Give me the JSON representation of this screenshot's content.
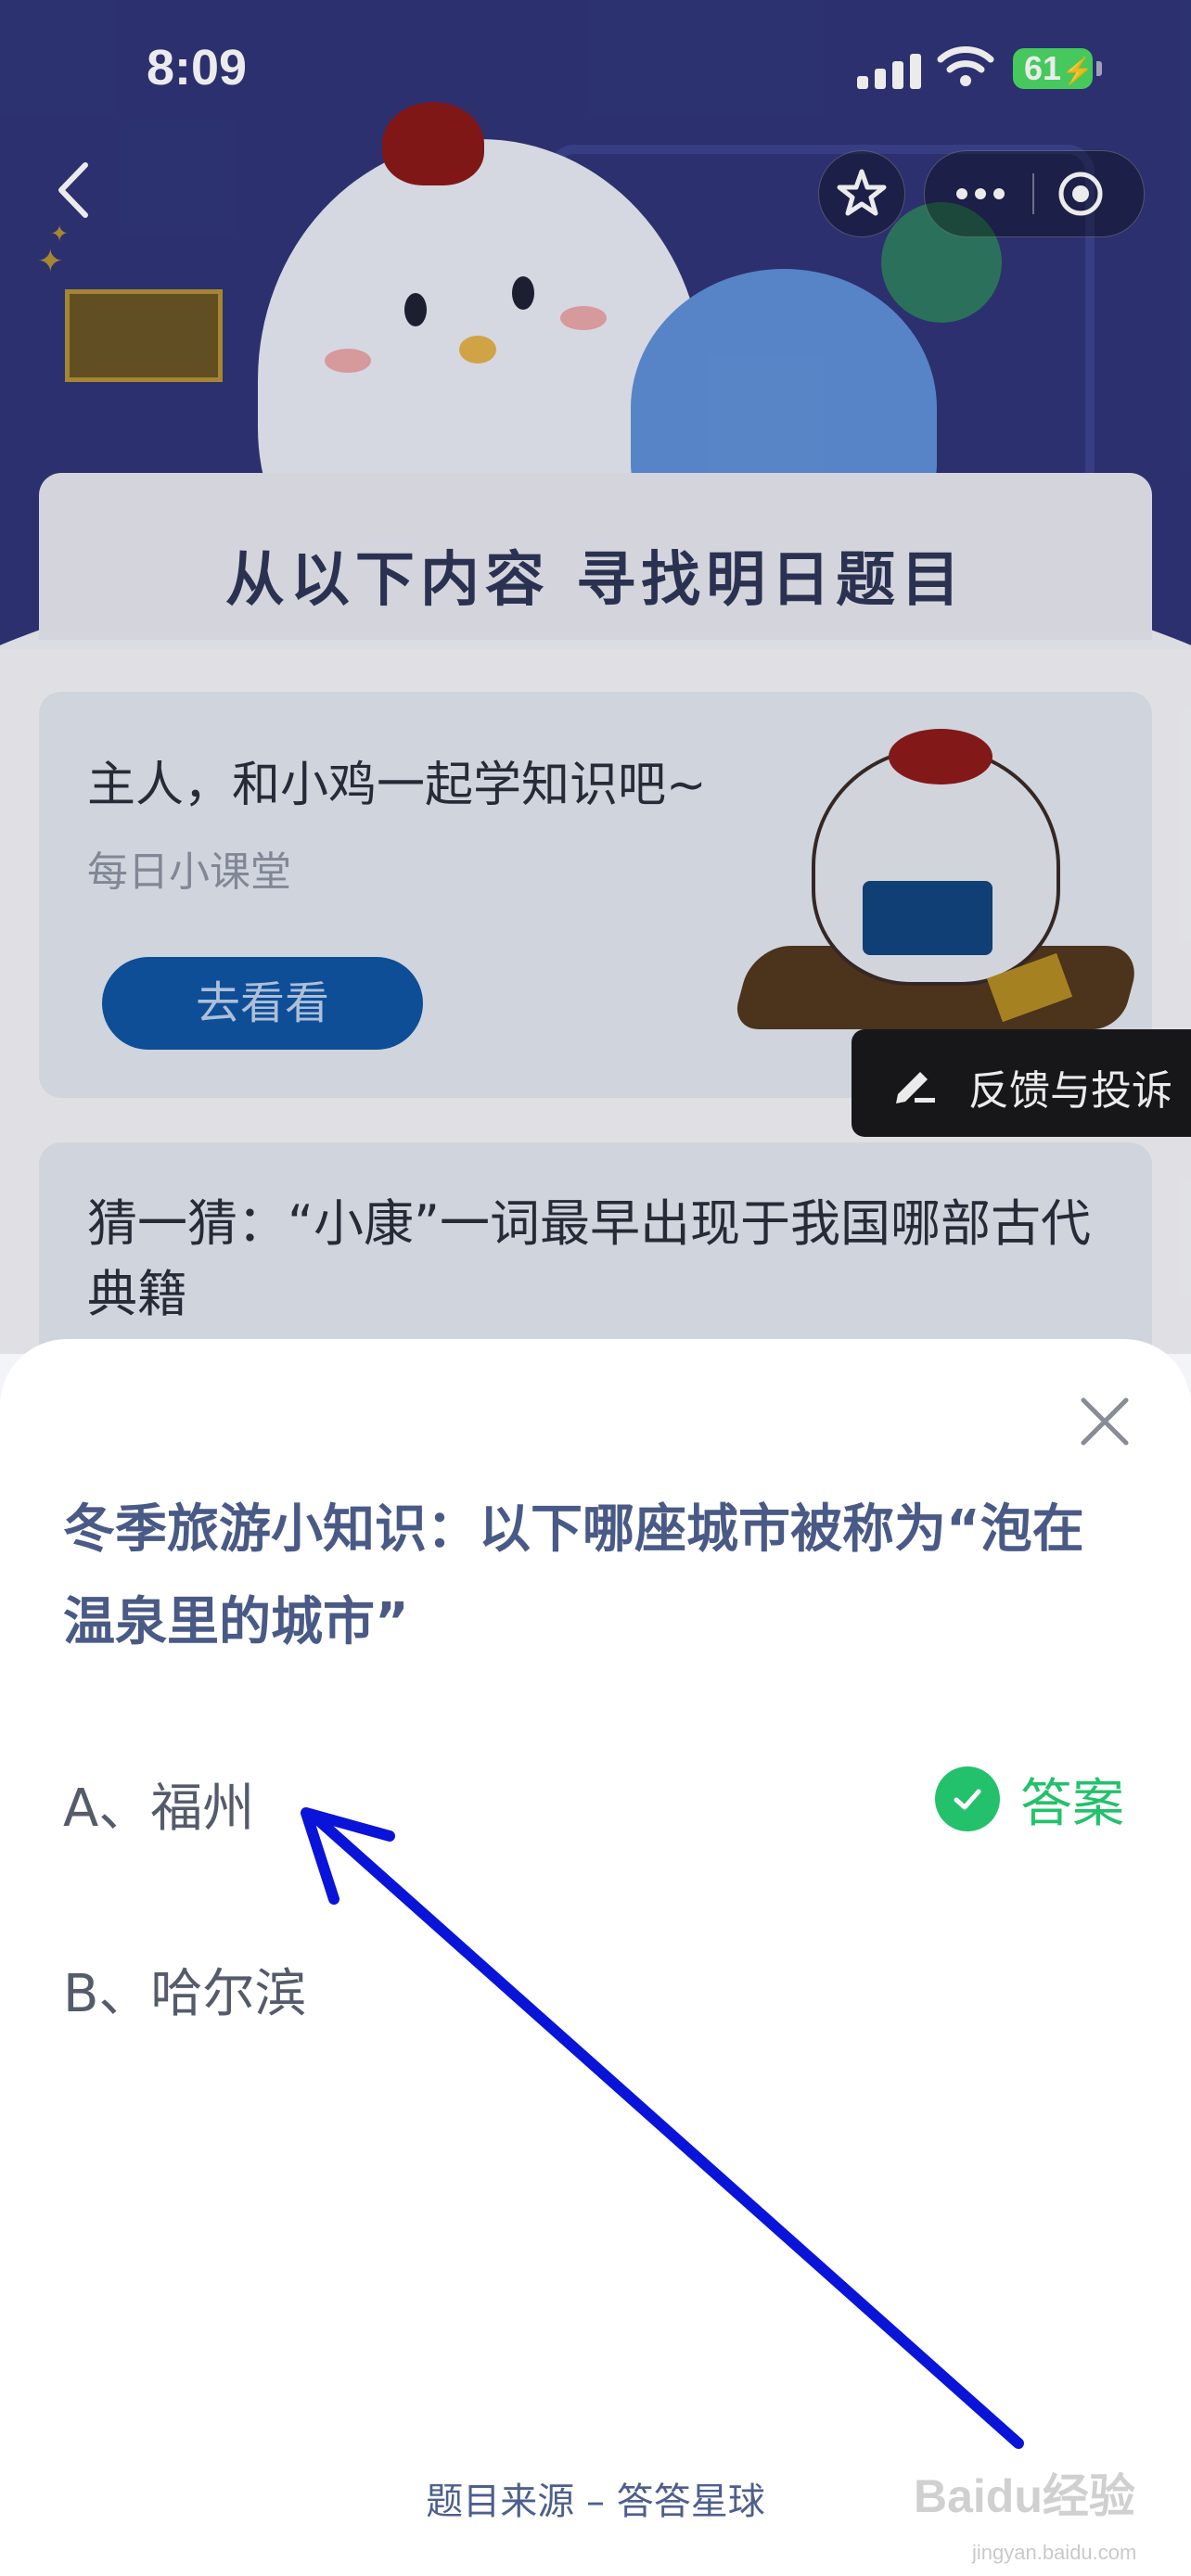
{
  "status_bar": {
    "time": "8:09",
    "battery": "61"
  },
  "header": {
    "section_title": "从以下内容 寻找明日题目"
  },
  "card1": {
    "title": "主人，和小鸡一起学知识吧~",
    "subtitle": "每日小课堂",
    "button_label": "去看看"
  },
  "feedback": {
    "label": "反馈与投诉"
  },
  "card2": {
    "title": "猜一猜：“小康”一词最早出现于我国哪部古代典籍"
  },
  "sheet": {
    "question": "冬季旅游小知识：以下哪座城市被称为“泡在温泉里的城市”",
    "options": [
      {
        "label": "A、福州"
      },
      {
        "label": "B、哈尔滨"
      }
    ],
    "answer_label": "答案",
    "source": "题目来源 – 答答星球"
  },
  "watermark": {
    "logo": "Baidu经验",
    "site": "jingyan.baidu.com"
  },
  "colors": {
    "accent_green": "#23c16b",
    "question_text": "#4a5a86",
    "hero_bg": "#303579",
    "annotation_arrow": "#0a14d8"
  }
}
